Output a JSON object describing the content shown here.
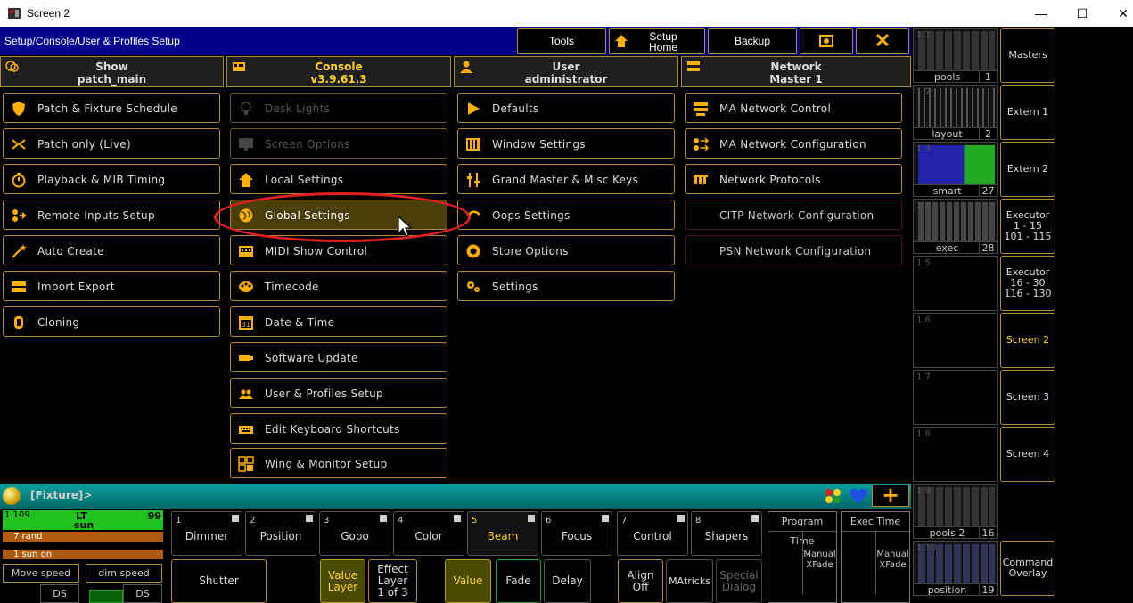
{
  "window": {
    "title": "Screen 2",
    "minimize": "—",
    "maximize": "☐",
    "close": "✕"
  },
  "topbar": {
    "path": "Setup/Console/User & Profiles Setup",
    "tools": "Tools",
    "setup_home_1": "Setup",
    "setup_home_2": "Home",
    "backup": "Backup",
    "close": "✕"
  },
  "tabs": [
    {
      "title": "Show",
      "sub": "patch_main"
    },
    {
      "title": "Console",
      "sub": "v3.9.61.3"
    },
    {
      "title": "User",
      "sub": "administrator"
    },
    {
      "title": "Network",
      "sub": "Master 1"
    }
  ],
  "col1": [
    "Patch & Fixture Schedule",
    "Patch only (Live)",
    "Playback & MIB Timing",
    "Remote Inputs Setup",
    "Auto Create",
    "Import Export",
    "Cloning"
  ],
  "col2": [
    "Desk Lights",
    "Screen Options",
    "Local Settings",
    "Global Settings",
    "MIDI Show Control",
    "Timecode",
    "Date & Time",
    "Software Update",
    "User & Profiles Setup",
    "Edit Keyboard Shortcuts",
    "Wing & Monitor Setup"
  ],
  "col3": [
    "Defaults",
    "Window Settings",
    "Grand Master & Misc Keys",
    "Oops Settings",
    "Store Options",
    "Settings"
  ],
  "col4": [
    "MA Network Control",
    "MA Network Configuration",
    "Network Protocols",
    "CITP Network Configuration",
    "PSN Network Configuration"
  ],
  "views": [
    {
      "num": "1.1",
      "cap": "pools",
      "n": "1"
    },
    {
      "num": "1.2",
      "cap": "layout",
      "n": "2"
    },
    {
      "num": "1.3",
      "cap": "smart",
      "n": "27"
    },
    {
      "num": "1.4",
      "cap": "exec",
      "n": "28"
    },
    {
      "num": "1.5",
      "cap": "",
      "n": ""
    },
    {
      "num": "1.6",
      "cap": "",
      "n": ""
    },
    {
      "num": "1.7",
      "cap": "",
      "n": ""
    },
    {
      "num": "1.8",
      "cap": "",
      "n": ""
    },
    {
      "num": "1.9",
      "cap": "pools 2",
      "n": "16"
    },
    {
      "num": "1.10",
      "cap": "position",
      "n": "19"
    }
  ],
  "screens": [
    "Masters",
    "Extern 1",
    "Extern 2",
    "Executor\n1 - 15\n101 - 115",
    "Executor\n16 - 30\n116 - 130",
    "Screen 2",
    "Screen 3",
    "Screen 4",
    "",
    "Command\nOverlay"
  ],
  "command": {
    "prompt": "[Fixture]>"
  },
  "fixture": {
    "id": "1.109",
    "name1": "LT",
    "name2": "sun",
    "value": "99",
    "row1": "7 rand",
    "row2": "1 sun on"
  },
  "speed": {
    "move": "Move speed",
    "dim": "dim speed",
    "ds1": "DS",
    "ds2": "DS"
  },
  "features": [
    {
      "n": "1",
      "label": "Dimmer"
    },
    {
      "n": "2",
      "label": "Position"
    },
    {
      "n": "3",
      "label": "Gobo"
    },
    {
      "n": "4",
      "label": "Color"
    },
    {
      "n": "5",
      "label": "Beam"
    },
    {
      "n": "6",
      "label": "Focus"
    },
    {
      "n": "7",
      "label": "Control"
    },
    {
      "n": "8",
      "label": "Shapers"
    }
  ],
  "bottom": {
    "shutter": "Shutter",
    "value_layer": "Value\nLayer",
    "effect_layer": "Effect\nLayer\n1 of 3",
    "value": "Value",
    "fade": "Fade",
    "delay": "Delay",
    "align_off": "Align\nOff",
    "matricks": "MAtricks",
    "special_dialog": "Special\nDialog",
    "program_time": "Program Time",
    "exec_time": "Exec Time",
    "manual_xfade": "Manual\nXFade"
  },
  "colors": {
    "accent": "#ffd21f",
    "border": "#b08a2e",
    "titlebar": "#00008b"
  }
}
